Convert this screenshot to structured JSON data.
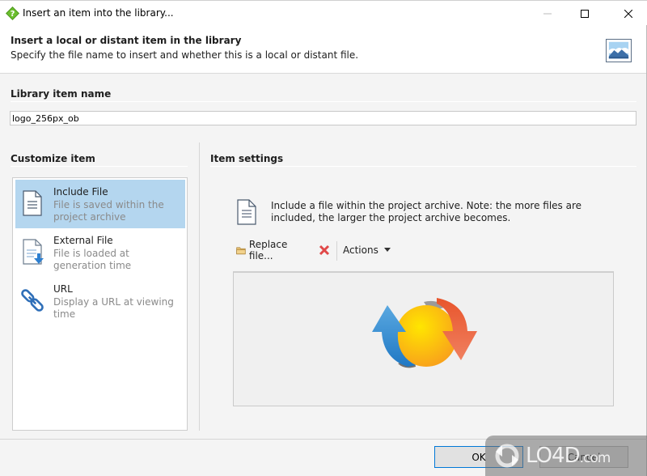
{
  "window": {
    "title": "Insert an item into the library...",
    "icon": "library-insert-icon",
    "controls": [
      "minimize-icon",
      "maximize-icon",
      "close-icon"
    ]
  },
  "header": {
    "title": "Insert a local or distant item in the library",
    "subtitle": "Specify the file name to insert and whether this is a local or distant file.",
    "icon": "image-icon"
  },
  "library_item": {
    "section_title": "Library item name",
    "name_value": "logo_256px_ob"
  },
  "customize": {
    "section_title": "Customize item",
    "items": [
      {
        "label": "Include File",
        "description": "File is saved within the project archive",
        "icon": "document-icon",
        "selected": true
      },
      {
        "label": "External File",
        "description": "File is loaded at generation time",
        "icon": "document-download-icon",
        "selected": false
      },
      {
        "label": "URL",
        "description": "Display a URL at viewing time",
        "icon": "link-icon",
        "selected": false
      }
    ]
  },
  "settings": {
    "section_title": "Item settings",
    "description": "Include a file within the project archive. Note: the more files are included, the larger the project archive becomes.",
    "toolbar": {
      "replace_label": "Replace file...",
      "remove_icon": "delete-icon",
      "actions_label": "Actions"
    },
    "preview_icon": "sync-arrows-logo"
  },
  "footer": {
    "ok_label": "OK",
    "cancel_label": "Cancel"
  },
  "watermark": {
    "text": "LO4D",
    "suffix": ".com"
  }
}
